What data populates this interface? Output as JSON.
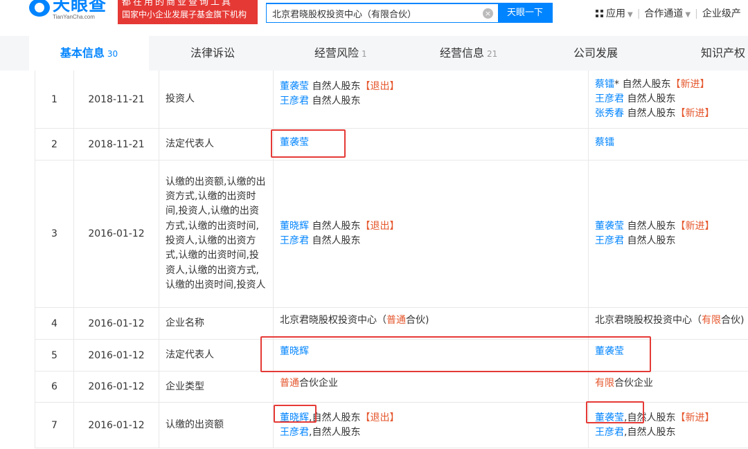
{
  "header": {
    "logo_text": "天眼查",
    "logo_sub": "TianYanCha.com",
    "promo_line1": "都在用的商业查询工具",
    "promo_line2": "国家中小企业发展子基金旗下机构",
    "search_value": "北京君晓股权投资中心（有限合伙）",
    "search_button": "天眼一下",
    "nav": [
      "应用",
      "合作通道",
      "企业级产"
    ]
  },
  "tabs": [
    {
      "label": "基本信息",
      "count": "30"
    },
    {
      "label": "法律诉讼",
      "count": ""
    },
    {
      "label": "经营风险",
      "count": "1"
    },
    {
      "label": "经营信息",
      "count": "21"
    },
    {
      "label": "公司发展",
      "count": ""
    },
    {
      "label": "知识产权",
      "count": ""
    }
  ],
  "rows": [
    {
      "no": "1",
      "date": "2018-11-21",
      "item": "投资人",
      "before": [
        {
          "name": "董袭莹",
          "role": "自然人股东",
          "tag": "【退出】"
        },
        {
          "name": "王彦君",
          "role": "自然人股东",
          "tag": ""
        }
      ],
      "after": [
        {
          "name": "蔡镭",
          "role": "* 自然人股东",
          "tag": "【新进】"
        },
        {
          "name": "王彦君",
          "role": "自然人股东",
          "tag": ""
        },
        {
          "name": "张秀春",
          "role": "自然人股东",
          "tag": "【新进】"
        }
      ]
    },
    {
      "no": "2",
      "date": "2018-11-21",
      "item": "法定代表人",
      "before_name": "董袭莹",
      "after_name": "蔡镭"
    },
    {
      "no": "3",
      "date": "2016-01-12",
      "item": "认缴的出资额,认缴的出资方式,认缴的出资时间,投资人,认缴的出资方式,认缴的出资时间,投资人,认缴的出资方式,认缴的出资时间,投资人,认缴的出资方式,认缴的出资时间,投资人",
      "before": [
        {
          "name": "董晓辉",
          "role": "自然人股东",
          "tag": "【退出】"
        },
        {
          "name": "王彦君",
          "role": "自然人股东",
          "tag": ""
        }
      ],
      "after": [
        {
          "name": "董袭莹",
          "role": "自然人股东",
          "tag": "【新进】"
        },
        {
          "name": "王彦君",
          "role": "自然人股东",
          "tag": ""
        }
      ]
    },
    {
      "no": "4",
      "date": "2016-01-12",
      "item": "企业名称",
      "before": {
        "pre": "北京君晓股权投资中心（",
        "hl": "普通",
        "post": "合伙)"
      },
      "after": {
        "pre": "北京君晓股权投资中心（",
        "hl": "有限",
        "post": "合伙)"
      }
    },
    {
      "no": "5",
      "date": "2016-01-12",
      "item": "法定代表人",
      "before_name": "董晓辉",
      "after_name": "董袭莹"
    },
    {
      "no": "6",
      "date": "2016-01-12",
      "item": "企业类型",
      "before": {
        "hl": "普通",
        "post": "合伙企业"
      },
      "after": {
        "hl": "有限",
        "post": "合伙企业"
      }
    },
    {
      "no": "7",
      "date": "2016-01-12",
      "item": "认缴的出资额",
      "before": [
        {
          "name": "董晓辉",
          "role": ",自然人股东",
          "tag": "【退出】"
        },
        {
          "name": "王彦君",
          "role": ",自然人股东",
          "tag": ""
        }
      ],
      "after": [
        {
          "name": "董袭莹",
          "role": ",自然人股东",
          "tag": "【新进】"
        },
        {
          "name": "王彦君",
          "role": ",自然人股东",
          "tag": ""
        }
      ]
    }
  ]
}
